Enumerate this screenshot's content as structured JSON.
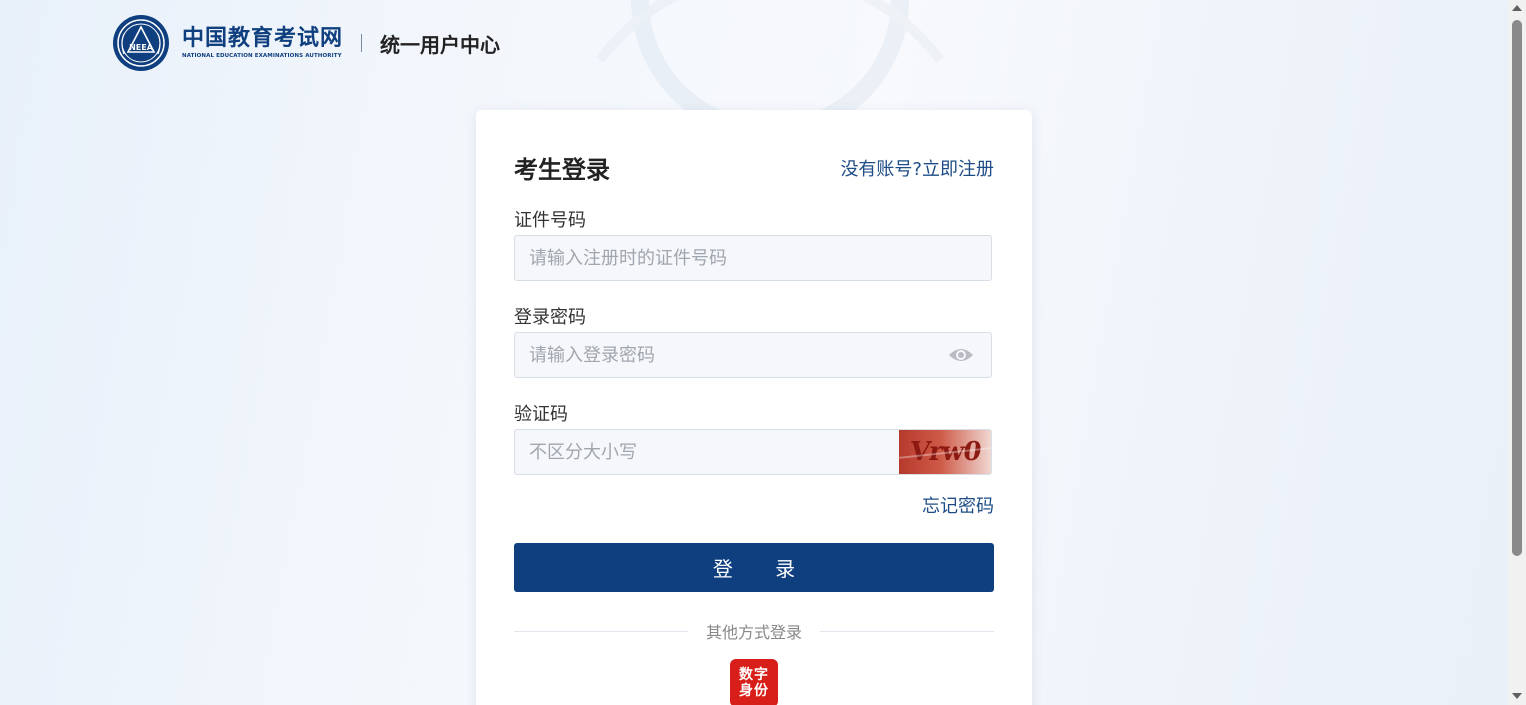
{
  "header": {
    "brand_cn": "中国教育考试网",
    "brand_en": "NATIONAL EDUCATION EXAMINATIONS AUTHORITY",
    "logo_text": "NEEA",
    "sub_title": "统一用户中心"
  },
  "login": {
    "title": "考生登录",
    "register_link": "没有账号?立即注册",
    "id_label": "证件号码",
    "id_placeholder": "请输入注册时的证件号码",
    "password_label": "登录密码",
    "password_placeholder": "请输入登录密码",
    "captcha_label": "验证码",
    "captcha_placeholder": "不区分大小写",
    "captcha_text": "Vrw0",
    "forgot_password": "忘记密码",
    "login_button": "登 录",
    "other_methods": "其他方式登录",
    "digital_id_line1": "数字",
    "digital_id_line2": "身份"
  },
  "colors": {
    "brand_blue": "#0f3f7f",
    "link_blue": "#1d4c86",
    "digital_id_red": "#d81e18"
  },
  "icons": {
    "password_toggle": "eye-icon",
    "logo": "neea-logo-icon"
  }
}
